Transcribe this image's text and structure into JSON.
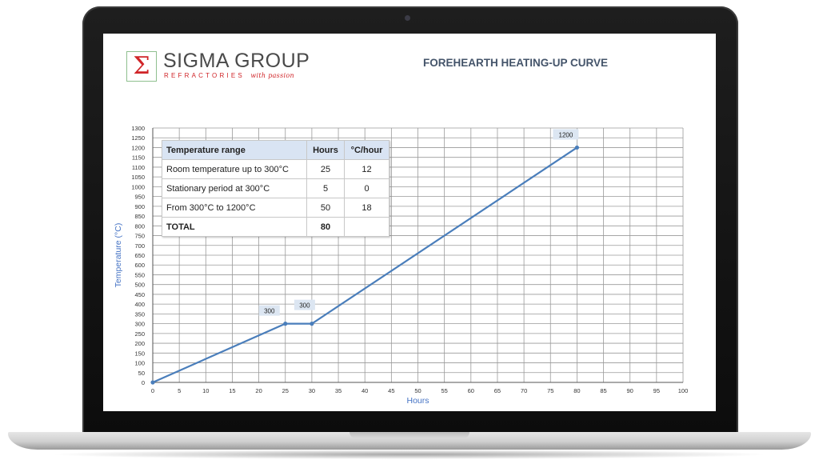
{
  "logo": {
    "symbol": "Σ",
    "name": "SIGMA GROUP",
    "subtitle": "REFRACTORIES",
    "tagline": "with passion",
    "brand_red": "#d02428"
  },
  "table": {
    "headers": [
      "Temperature range",
      "Hours",
      "°C/hour"
    ],
    "rows": [
      [
        "Room temperature up to 300°C",
        "25",
        "12"
      ],
      [
        "Stationary period at 300°C",
        "5",
        "0"
      ],
      [
        "From 300°C to 1200°C",
        "50",
        "18"
      ]
    ],
    "total": [
      "TOTAL",
      "80",
      ""
    ]
  },
  "chart_data": {
    "type": "line",
    "title": "FOREHEARTH HEATING-UP CURVE",
    "xlabel": "Hours",
    "ylabel": "Temperature (°C)",
    "xlim": [
      0,
      100
    ],
    "ylim": [
      0,
      1300
    ],
    "xticks": [
      0,
      5,
      10,
      15,
      20,
      25,
      30,
      35,
      40,
      45,
      50,
      55,
      60,
      65,
      70,
      75,
      80,
      85,
      90,
      95,
      100
    ],
    "yticks": [
      0,
      50,
      100,
      150,
      200,
      250,
      300,
      350,
      400,
      450,
      500,
      550,
      600,
      650,
      700,
      750,
      800,
      850,
      900,
      950,
      1000,
      1050,
      1100,
      1150,
      1200,
      1250,
      1300
    ],
    "grid": true,
    "series": [
      {
        "x": [
          0,
          25,
          30,
          80
        ],
        "y": [
          0,
          300,
          300,
          1200
        ],
        "color": "#4a7ebb"
      }
    ],
    "data_labels": [
      {
        "x": 25,
        "y": 300,
        "text": "300"
      },
      {
        "x": 30,
        "y": 300,
        "text": "300"
      },
      {
        "x": 80,
        "y": 1200,
        "text": "1200"
      }
    ],
    "label_bg": "#dce6f2",
    "axis_label_color": "#4472c4"
  }
}
